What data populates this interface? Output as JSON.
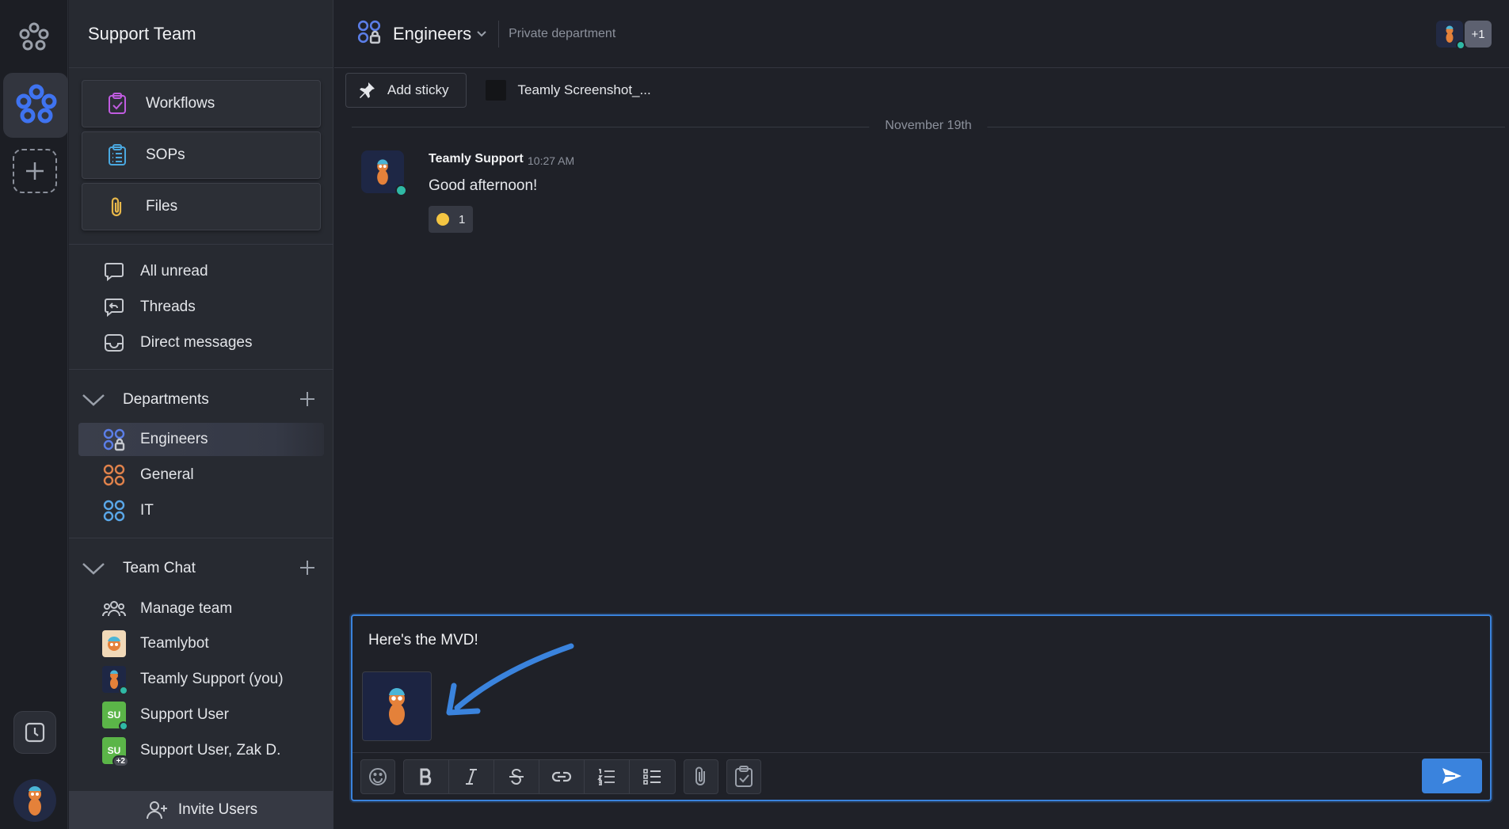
{
  "rail": {
    "logo_icon": "teamly-flower-icon",
    "workspace_icon": "teamly-workspace-icon",
    "add_workspace_icon": "plus-icon",
    "history_icon": "clock-icon",
    "profile_icon": "avatar-mascot"
  },
  "sidebar": {
    "team_name": "Support Team",
    "cards": [
      {
        "label": "Workflows",
        "icon": "workflow-clipboard-icon"
      },
      {
        "label": "SOPs",
        "icon": "list-clipboard-icon"
      },
      {
        "label": "Files",
        "icon": "paperclip-icon"
      }
    ],
    "nav": [
      {
        "label": "All unread",
        "icon": "chat-bubble-icon"
      },
      {
        "label": "Threads",
        "icon": "thread-reply-icon"
      },
      {
        "label": "Direct messages",
        "icon": "inbox-icon"
      }
    ],
    "departments": {
      "title": "Departments",
      "items": [
        {
          "label": "Engineers",
          "color": "#5b7ee8",
          "locked": true,
          "active": true
        },
        {
          "label": "General",
          "color": "#e0824b",
          "locked": false,
          "active": false
        },
        {
          "label": "IT",
          "color": "#5aa7e8",
          "locked": false,
          "active": false
        }
      ]
    },
    "team_chat": {
      "title": "Team Chat",
      "items": [
        {
          "label": "Manage team",
          "icon": "people-group-icon"
        },
        {
          "label": "Teamlybot",
          "icon": "bot-avatar"
        },
        {
          "label": "Teamly Support (you)",
          "icon": "mascot-avatar"
        },
        {
          "label": "Support User",
          "initials": "SU"
        },
        {
          "label": "Support User, Zak D.",
          "initials": "SU",
          "extra": "+2"
        }
      ]
    },
    "invite_label": "Invite Users"
  },
  "header": {
    "channel": "Engineers",
    "subtitle": "Private department",
    "extra_members": "+1"
  },
  "toolbar": {
    "sticky_label": "Add sticky",
    "file_label": "Teamly Screenshot_..."
  },
  "date_separator": "November 19th",
  "message": {
    "author": "Teamly Support",
    "time": "10:27 AM",
    "text": "Good afternoon!",
    "reaction_count": "1"
  },
  "composer": {
    "text": "Here's the MVD!",
    "accent": "#3a83dd"
  }
}
